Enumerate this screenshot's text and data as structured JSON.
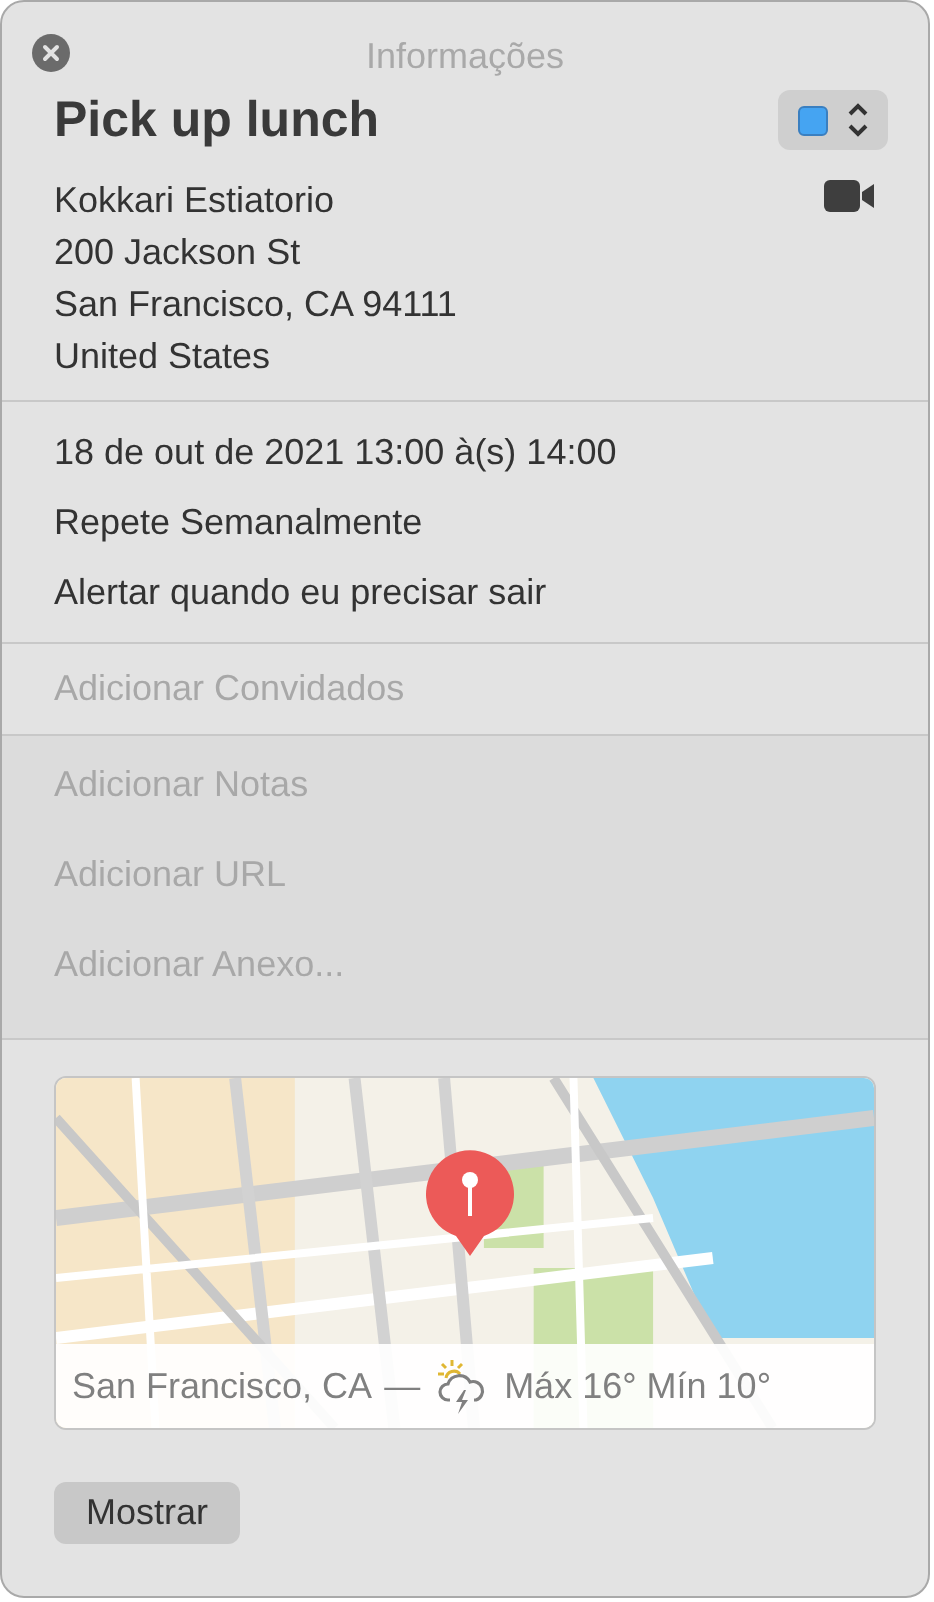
{
  "window": {
    "title": "Informações"
  },
  "event": {
    "title": "Pick up lunch",
    "calendar": {
      "color": "#45a4f2"
    }
  },
  "location": [
    "Kokkari Estiatorio",
    "200 Jackson St",
    "San Francisco, CA  94111",
    "United States"
  ],
  "schedule": [
    "18 de out de 2021  13:00 à(s) 14:00",
    "Repete Semanalmente",
    "Alertar quando eu precisar sair"
  ],
  "invitees": {
    "placeholder": "Adicionar Convidados"
  },
  "extras": [
    {
      "placeholder": "Adicionar Notas"
    },
    {
      "placeholder": "Adicionar URL"
    },
    {
      "placeholder": "Adicionar Anexo..."
    }
  ],
  "map": {
    "kind": "picture",
    "place": "San Francisco, CA",
    "separator": "—",
    "weather": "Máx 16° Mín 10°"
  },
  "buttons": [
    "Mostrar"
  ]
}
